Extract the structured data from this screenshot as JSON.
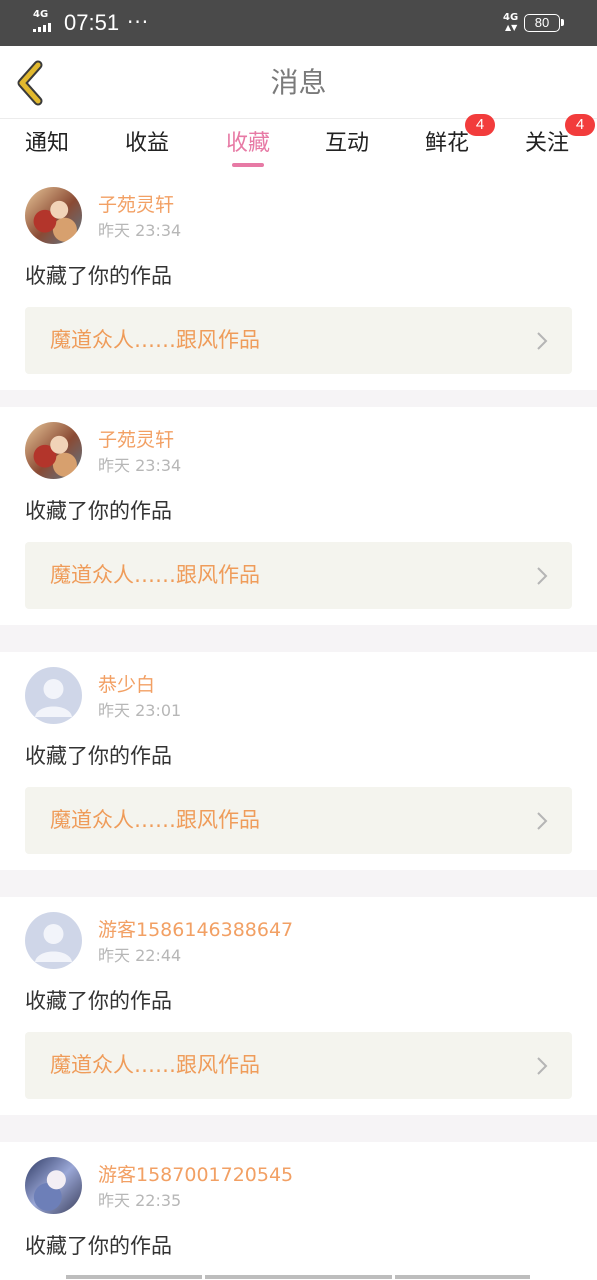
{
  "status_bar": {
    "network_left": "4G",
    "time": "07:51",
    "dots": "···",
    "network_right": "4G",
    "battery": "80"
  },
  "header": {
    "title": "消息",
    "back_icon": "chevron-left-icon"
  },
  "tabs": [
    {
      "label": "通知",
      "active": false,
      "badge": ""
    },
    {
      "label": "收益",
      "active": false,
      "badge": ""
    },
    {
      "label": "收藏",
      "active": true,
      "badge": ""
    },
    {
      "label": "互动",
      "active": false,
      "badge": ""
    },
    {
      "label": "鲜花",
      "active": false,
      "badge": "4"
    },
    {
      "label": "关注",
      "active": false,
      "badge": "4"
    }
  ],
  "notifications": [
    {
      "username": "子苑灵轩",
      "time": "昨天 23:34",
      "action": "收藏了你的作品",
      "work": "魔道众人……跟风作品",
      "avatar": "artwork-avatar"
    },
    {
      "username": "子苑灵轩",
      "time": "昨天 23:34",
      "action": "收藏了你的作品",
      "work": "魔道众人……跟风作品",
      "avatar": "artwork-avatar"
    },
    {
      "username": "恭少白",
      "time": "昨天 23:01",
      "action": "收藏了你的作品",
      "work": "魔道众人……跟风作品",
      "avatar": "default-user-avatar"
    },
    {
      "username": "游客1586146388647",
      "time": "昨天 22:44",
      "action": "收藏了你的作品",
      "work": "魔道众人……跟风作品",
      "avatar": "default-user-avatar"
    },
    {
      "username": "游客1587001720545",
      "time": "昨天 22:35",
      "action": "收藏了你的作品",
      "work": "",
      "avatar": "artwork-avatar"
    }
  ],
  "colors": {
    "accent": "#e77aa5",
    "username": "#f2a064",
    "work_title": "#ef9c5a",
    "badge": "#f23c3c",
    "back_icon": "#e2b92e"
  }
}
